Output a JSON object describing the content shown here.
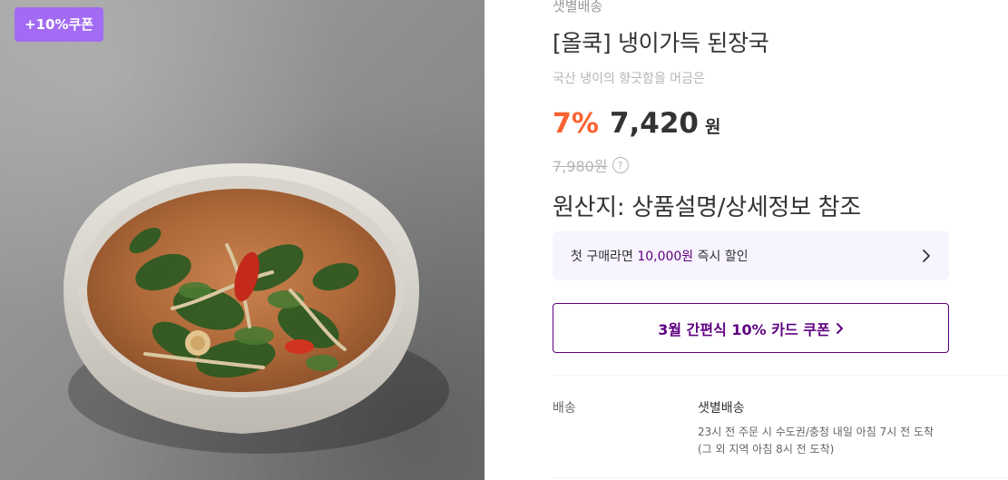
{
  "badge": {
    "label": "+10%쿠폰",
    "color": "#a36bf3"
  },
  "product": {
    "delivery_tag": "샛별배송",
    "title": "[올쿡] 냉이가득 된장국",
    "subtitle": "국산 냉이의 향긋함을 머금은",
    "discount": "7%",
    "sale_price": "7,420",
    "currency": "원",
    "original_price": "7,980원",
    "help_icon": "?",
    "origin": "원산지: 상품설명/상세정보 참조"
  },
  "promo": {
    "prefix": "첫 구매라면 ",
    "highlight": "10,000원",
    "suffix": " 즉시 할인",
    "icon": "chevron-right-icon"
  },
  "card_coupon": {
    "label": "3월 간편식 10% 카드 쿠폰",
    "icon": "chevron-right-icon"
  },
  "shipping": {
    "label": "배송",
    "title": "샛별배송",
    "line1": "23시 전 주문 시 수도권/충청 내일 아침 7시 전 도착",
    "line2": "(그 외 지역 아침 8시 전 도착)"
  },
  "colors": {
    "accent_purple": "#5f0080",
    "discount_orange": "#fa622f",
    "promo_bg": "#f7f3ff"
  }
}
